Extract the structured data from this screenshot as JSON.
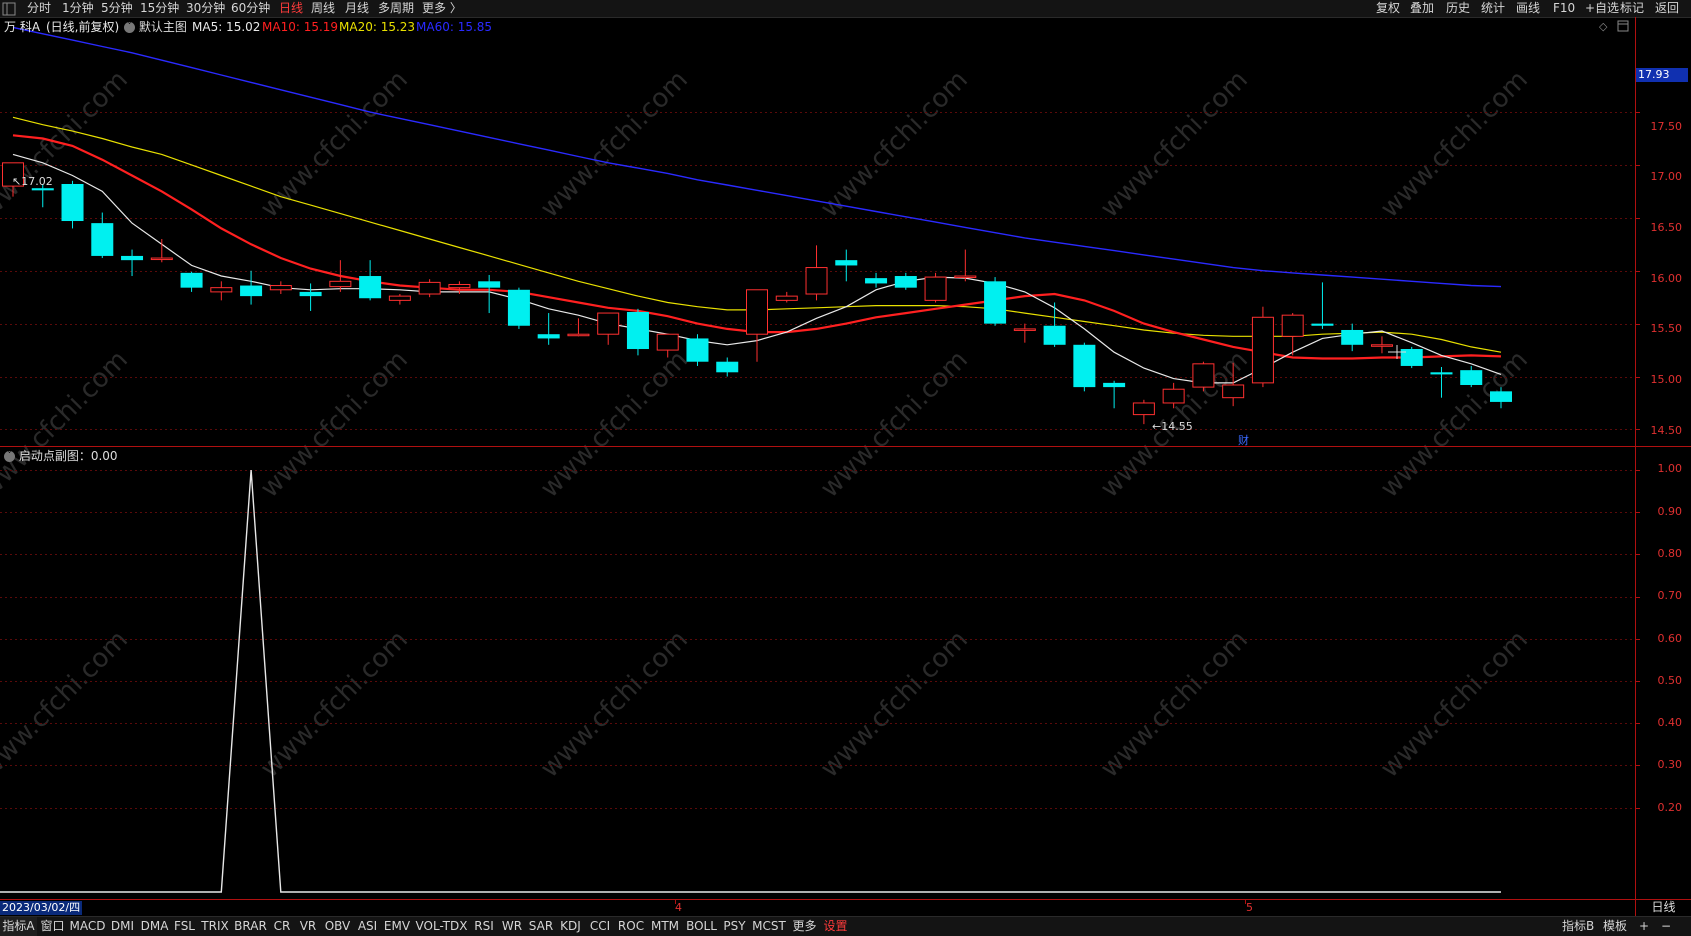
{
  "topbar": {
    "periods": [
      "分时",
      "1分钟",
      "5分钟",
      "15分钟",
      "30分钟",
      "60分钟",
      "日线",
      "周线",
      "月线",
      "多周期",
      "更多 〉"
    ],
    "active_period": "日线",
    "right_tools": [
      "复权",
      "叠加",
      "历史",
      "统计",
      "画线",
      "F10",
      "+自选",
      "标记",
      "返回"
    ]
  },
  "main": {
    "stock_label": "万 科A",
    "mode_label": "(日线,前复权)",
    "template_label": "默认主图",
    "ma": [
      {
        "name": "MA5",
        "value": "15.02",
        "color": "#e8e8e8",
        "label": "MA5: 15.02"
      },
      {
        "name": "MA10",
        "value": "15.19",
        "color": "#ff2020",
        "label": "MA10: 15.19"
      },
      {
        "name": "MA20",
        "value": "15.23",
        "color": "#e8e000",
        "label": "MA20: 15.23"
      },
      {
        "name": "MA60",
        "value": "15.85",
        "color": "#2a2aff",
        "label": "MA60: 15.85"
      }
    ],
    "current_price_tag": "17.93",
    "y_ticks": [
      "17.50",
      "17.00",
      "16.50",
      "16.00",
      "15.50",
      "15.00",
      "14.50"
    ],
    "high_marker": "17.02",
    "low_marker": "←14.55",
    "finance_marker": "财"
  },
  "indicator": {
    "title": "启动点副图：0.00",
    "y_ticks": [
      "1.00",
      "0.90",
      "0.80",
      "0.70",
      "0.60",
      "0.50",
      "0.40",
      "0.30",
      "0.20"
    ]
  },
  "x_axis": {
    "date_label": "2023/03/02/四",
    "month_marks": [
      "4",
      "5"
    ]
  },
  "right_axis_bottom": "日线",
  "watermark": "www.cfchi.com",
  "bottombar": {
    "tabs": [
      "指标A",
      "窗口",
      "MACD",
      "DMI",
      "DMA",
      "FSL",
      "TRIX",
      "BRAR",
      "CR",
      "VR",
      "OBV",
      "ASI",
      "EMV",
      "VOL-TDX",
      "RSI",
      "WR",
      "SAR",
      "KDJ",
      "CCI",
      "ROC",
      "MTM",
      "BOLL",
      "PSY",
      "MCST",
      "更多",
      "设置"
    ],
    "right": [
      "指标B",
      "模板",
      "+",
      "−"
    ]
  },
  "chart_data": {
    "type": "candlestick",
    "candles": [
      {
        "o": 16.8,
        "h": 17.02,
        "l": 16.7,
        "c": 17.02
      },
      {
        "o": 16.78,
        "h": 16.82,
        "l": 16.6,
        "c": 16.76
      },
      {
        "o": 16.82,
        "h": 16.85,
        "l": 16.4,
        "c": 16.47
      },
      {
        "o": 16.45,
        "h": 16.55,
        "l": 16.12,
        "c": 16.14
      },
      {
        "o": 16.14,
        "h": 16.2,
        "l": 15.95,
        "c": 16.1
      },
      {
        "o": 16.12,
        "h": 16.3,
        "l": 16.08,
        "c": 16.12
      },
      {
        "o": 15.98,
        "h": 15.99,
        "l": 15.8,
        "c": 15.84
      },
      {
        "o": 15.8,
        "h": 15.9,
        "l": 15.72,
        "c": 15.84
      },
      {
        "o": 15.86,
        "h": 16.0,
        "l": 15.68,
        "c": 15.76
      },
      {
        "o": 15.82,
        "h": 15.9,
        "l": 15.78,
        "c": 15.86
      },
      {
        "o": 15.8,
        "h": 15.88,
        "l": 15.62,
        "c": 15.76
      },
      {
        "o": 15.85,
        "h": 16.1,
        "l": 15.8,
        "c": 15.9
      },
      {
        "o": 15.95,
        "h": 16.1,
        "l": 15.72,
        "c": 15.74
      },
      {
        "o": 15.72,
        "h": 15.78,
        "l": 15.68,
        "c": 15.76
      },
      {
        "o": 15.78,
        "h": 15.92,
        "l": 15.75,
        "c": 15.89
      },
      {
        "o": 15.84,
        "h": 15.9,
        "l": 15.78,
        "c": 15.87
      },
      {
        "o": 15.9,
        "h": 15.96,
        "l": 15.6,
        "c": 15.84
      },
      {
        "o": 15.82,
        "h": 15.84,
        "l": 15.45,
        "c": 15.48
      },
      {
        "o": 15.4,
        "h": 15.6,
        "l": 15.3,
        "c": 15.36
      },
      {
        "o": 15.4,
        "h": 15.55,
        "l": 15.38,
        "c": 15.4
      },
      {
        "o": 15.4,
        "h": 15.6,
        "l": 15.3,
        "c": 15.6
      },
      {
        "o": 15.61,
        "h": 15.64,
        "l": 15.2,
        "c": 15.26
      },
      {
        "o": 15.25,
        "h": 15.4,
        "l": 15.18,
        "c": 15.4
      },
      {
        "o": 15.36,
        "h": 15.4,
        "l": 15.1,
        "c": 15.14
      },
      {
        "o": 15.14,
        "h": 15.18,
        "l": 15.0,
        "c": 15.04
      },
      {
        "o": 15.4,
        "h": 15.82,
        "l": 15.14,
        "c": 15.82
      },
      {
        "o": 15.72,
        "h": 15.8,
        "l": 15.7,
        "c": 15.76
      },
      {
        "o": 15.78,
        "h": 16.24,
        "l": 15.72,
        "c": 16.03
      },
      {
        "o": 16.1,
        "h": 16.2,
        "l": 15.9,
        "c": 16.05
      },
      {
        "o": 15.93,
        "h": 15.98,
        "l": 15.84,
        "c": 15.88
      },
      {
        "o": 15.95,
        "h": 15.98,
        "l": 15.82,
        "c": 15.84
      },
      {
        "o": 15.72,
        "h": 15.98,
        "l": 15.7,
        "c": 15.94
      },
      {
        "o": 15.94,
        "h": 16.2,
        "l": 15.9,
        "c": 15.95
      },
      {
        "o": 15.9,
        "h": 15.94,
        "l": 15.48,
        "c": 15.5
      },
      {
        "o": 15.45,
        "h": 15.5,
        "l": 15.32,
        "c": 15.45
      },
      {
        "o": 15.48,
        "h": 15.7,
        "l": 15.28,
        "c": 15.3
      },
      {
        "o": 15.3,
        "h": 15.32,
        "l": 14.86,
        "c": 14.9
      },
      {
        "o": 14.94,
        "h": 14.96,
        "l": 14.7,
        "c": 14.9
      },
      {
        "o": 14.64,
        "h": 14.78,
        "l": 14.55,
        "c": 14.75
      },
      {
        "o": 14.75,
        "h": 14.94,
        "l": 14.7,
        "c": 14.88
      },
      {
        "o": 14.9,
        "h": 15.14,
        "l": 14.86,
        "c": 15.12
      },
      {
        "o": 14.8,
        "h": 15.13,
        "l": 14.72,
        "c": 14.92
      },
      {
        "o": 14.94,
        "h": 15.66,
        "l": 14.9,
        "c": 15.56
      },
      {
        "o": 15.38,
        "h": 15.6,
        "l": 15.2,
        "c": 15.58
      },
      {
        "o": 15.5,
        "h": 15.89,
        "l": 15.45,
        "c": 15.48
      },
      {
        "o": 15.44,
        "h": 15.5,
        "l": 15.24,
        "c": 15.3
      },
      {
        "o": 15.3,
        "h": 15.38,
        "l": 15.22,
        "c": 15.3
      },
      {
        "o": 15.26,
        "h": 15.28,
        "l": 15.08,
        "c": 15.1
      },
      {
        "o": 15.04,
        "h": 15.09,
        "l": 14.8,
        "c": 15.02
      },
      {
        "o": 15.06,
        "h": 15.1,
        "l": 14.9,
        "c": 14.92
      },
      {
        "o": 14.86,
        "h": 14.9,
        "l": 14.7,
        "c": 14.76
      }
    ],
    "ma5": [
      17.1,
      17.02,
      16.9,
      16.75,
      16.45,
      16.25,
      16.05,
      15.95,
      15.9,
      15.84,
      15.82,
      15.83,
      15.83,
      15.82,
      15.8,
      15.8,
      15.8,
      15.73,
      15.64,
      15.58,
      15.5,
      15.45,
      15.4,
      15.34,
      15.3,
      15.34,
      15.42,
      15.55,
      15.66,
      15.82,
      15.9,
      15.94,
      15.93,
      15.88,
      15.8,
      15.65,
      15.45,
      15.23,
      15.08,
      14.98,
      14.94,
      14.94,
      15.08,
      15.23,
      15.36,
      15.4,
      15.43,
      15.32,
      15.2,
      15.12,
      15.02
    ],
    "ma10": [
      17.28,
      17.25,
      17.18,
      17.05,
      16.9,
      16.75,
      16.58,
      16.4,
      16.25,
      16.12,
      16.02,
      15.95,
      15.9,
      15.86,
      15.84,
      15.82,
      15.82,
      15.8,
      15.75,
      15.7,
      15.65,
      15.62,
      15.57,
      15.5,
      15.45,
      15.42,
      15.42,
      15.45,
      15.5,
      15.56,
      15.6,
      15.64,
      15.68,
      15.72,
      15.76,
      15.78,
      15.72,
      15.62,
      15.5,
      15.42,
      15.35,
      15.28,
      15.23,
      15.18,
      15.17,
      15.17,
      15.18,
      15.18,
      15.19,
      15.2,
      15.19
    ],
    "ma20": [
      17.45,
      17.38,
      17.32,
      17.25,
      17.17,
      17.1,
      17.0,
      16.9,
      16.8,
      16.7,
      16.62,
      16.54,
      16.46,
      16.38,
      16.3,
      16.22,
      16.14,
      16.06,
      15.98,
      15.9,
      15.83,
      15.76,
      15.7,
      15.66,
      15.63,
      15.63,
      15.64,
      15.65,
      15.66,
      15.67,
      15.67,
      15.67,
      15.66,
      15.64,
      15.6,
      15.56,
      15.52,
      15.48,
      15.44,
      15.41,
      15.39,
      15.38,
      15.38,
      15.38,
      15.4,
      15.41,
      15.42,
      15.4,
      15.35,
      15.28,
      15.23
    ],
    "ma60": [
      18.3,
      18.24,
      18.18,
      18.12,
      18.06,
      17.99,
      17.92,
      17.85,
      17.78,
      17.71,
      17.64,
      17.57,
      17.5,
      17.44,
      17.38,
      17.32,
      17.26,
      17.2,
      17.14,
      17.08,
      17.02,
      16.97,
      16.92,
      16.86,
      16.81,
      16.76,
      16.71,
      16.66,
      16.61,
      16.56,
      16.51,
      16.46,
      16.41,
      16.36,
      16.31,
      16.27,
      16.23,
      16.19,
      16.15,
      16.11,
      16.07,
      16.03,
      16.0,
      15.98,
      15.96,
      15.94,
      15.92,
      15.9,
      15.88,
      15.86,
      15.85
    ],
    "indicator_values": [
      0,
      0,
      0,
      0,
      0,
      0,
      0,
      0,
      1,
      0,
      0,
      0,
      0,
      0,
      0,
      0,
      0,
      0,
      0,
      0,
      0,
      0,
      0,
      0,
      0,
      0,
      0,
      0,
      0,
      0,
      0,
      0,
      0,
      0,
      0,
      0,
      0,
      0,
      0,
      0,
      0,
      0,
      0,
      0,
      0,
      0,
      0,
      0,
      0,
      0,
      0
    ],
    "ylim_main": [
      14.4,
      18.2
    ],
    "ylim_indicator": [
      0,
      1.0
    ]
  }
}
